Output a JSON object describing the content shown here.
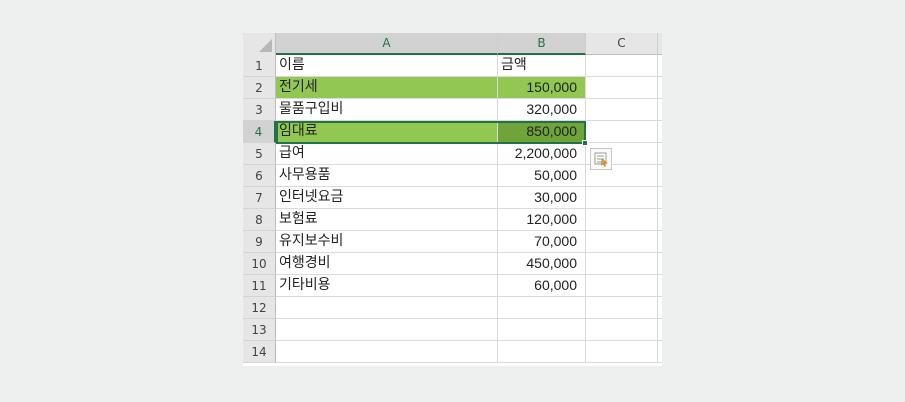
{
  "columns": [
    {
      "label": "A",
      "selected": true
    },
    {
      "label": "B",
      "selected": true
    },
    {
      "label": "C",
      "selected": false
    },
    {
      "label": "",
      "selected": false
    }
  ],
  "rows": [
    {
      "num": "1",
      "name": "이름",
      "amount": "금액",
      "highlight": false,
      "selected": false
    },
    {
      "num": "2",
      "name": "전기세",
      "amount": "150,000",
      "highlight": true,
      "selected": false
    },
    {
      "num": "3",
      "name": "물품구입비",
      "amount": "320,000",
      "highlight": false,
      "selected": false
    },
    {
      "num": "4",
      "name": "임대료",
      "amount": "850,000",
      "highlight": true,
      "selected": true
    },
    {
      "num": "5",
      "name": "급여",
      "amount": "2,200,000",
      "highlight": false,
      "selected": false
    },
    {
      "num": "6",
      "name": "사무용품",
      "amount": "50,000",
      "highlight": false,
      "selected": false
    },
    {
      "num": "7",
      "name": "인터넷요금",
      "amount": "30,000",
      "highlight": false,
      "selected": false
    },
    {
      "num": "8",
      "name": "보험료",
      "amount": "120,000",
      "highlight": false,
      "selected": false
    },
    {
      "num": "9",
      "name": "유지보수비",
      "amount": "70,000",
      "highlight": false,
      "selected": false
    },
    {
      "num": "10",
      "name": "여행경비",
      "amount": "450,000",
      "highlight": false,
      "selected": false
    },
    {
      "num": "11",
      "name": "기타비용",
      "amount": "60,000",
      "highlight": false,
      "selected": false
    },
    {
      "num": "12",
      "name": "",
      "amount": "",
      "highlight": false,
      "selected": false
    },
    {
      "num": "13",
      "name": "",
      "amount": "",
      "highlight": false,
      "selected": false
    },
    {
      "num": "14",
      "name": "",
      "amount": "",
      "highlight": false,
      "selected": false
    }
  ],
  "colors": {
    "highlight": "#92c852",
    "highlight_active": "#6ea43a",
    "selection": "#217346"
  },
  "quick_analysis": {
    "icon": "quick-analysis-icon"
  }
}
